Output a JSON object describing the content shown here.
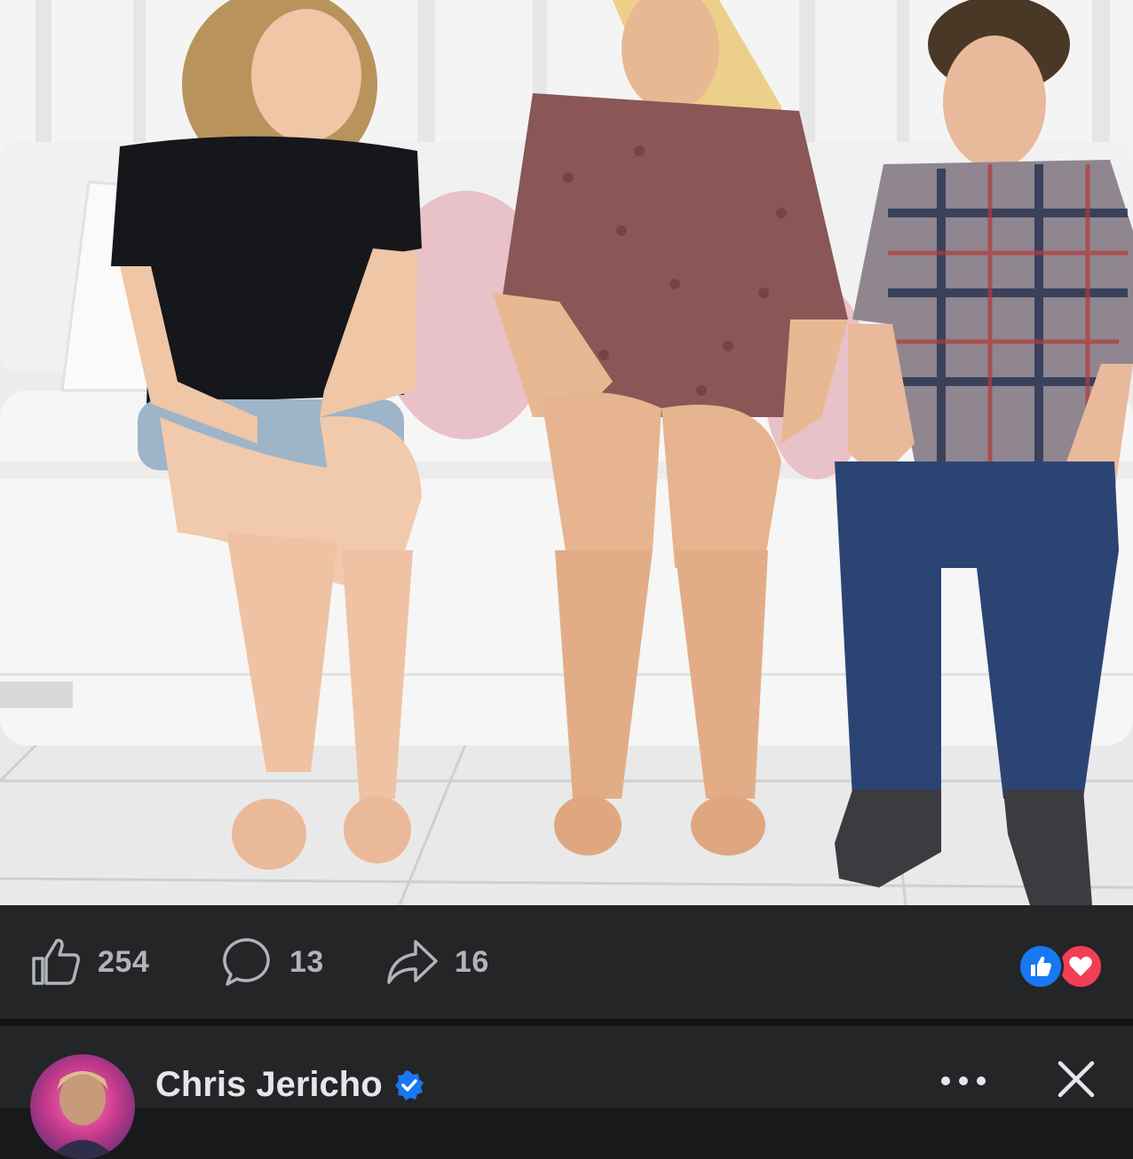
{
  "post": {
    "photo_alt": "",
    "stats": {
      "likes": "254",
      "comments": "13",
      "shares": "16"
    },
    "reactions": [
      "like-icon",
      "love-icon"
    ],
    "colors": {
      "like_blue": "#1877f2",
      "love_red": "#f33e58",
      "bar_bg": "#242526",
      "text_muted": "#b0b3b8"
    }
  },
  "next_post": {
    "author": "Chris Jericho",
    "verified": true
  }
}
